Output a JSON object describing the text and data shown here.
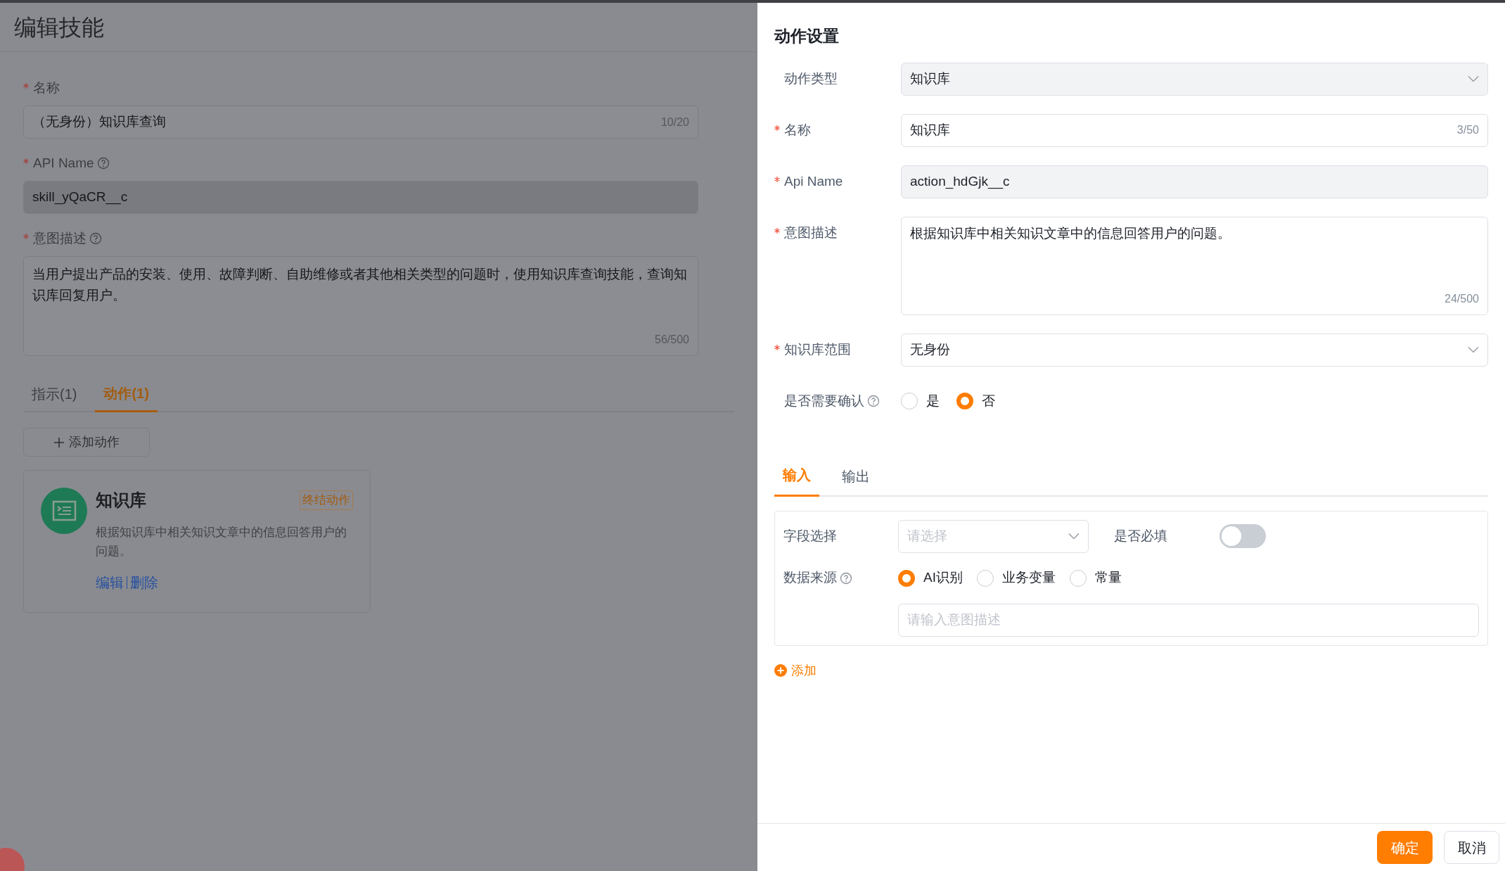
{
  "page": {
    "title": "编辑技能",
    "fields": [
      {
        "label": "名称",
        "required": true,
        "help": false,
        "kind": "input",
        "value": "（无身份）知识库查询",
        "counter": "10/20",
        "disabled": false
      },
      {
        "label": "API Name",
        "required": true,
        "help": true,
        "kind": "input",
        "value": "skill_yQaCR__c",
        "disabled": true
      },
      {
        "label": "意图描述",
        "required": true,
        "help": true,
        "kind": "textarea",
        "value": "当用户提出产品的安装、使用、故障判断、自助维修或者其他相关类型的问题时，使用知识库查询技能，查询知识库回复用户。",
        "counter": "56/500",
        "disabled": false
      }
    ],
    "tabs": [
      {
        "label": "指示(1)",
        "selected": false
      },
      {
        "label": "动作(1)",
        "selected": true
      }
    ],
    "add_action_button": "添加动作",
    "action_card": {
      "title": "知识库",
      "tag": "终结动作",
      "description": "根据知识库中相关知识文章中的信息回答用户的问题。",
      "links": [
        "编辑",
        "删除"
      ]
    }
  },
  "drawer": {
    "title": "动作设置",
    "fields": [
      {
        "label": "动作类型",
        "required": false,
        "help": false,
        "kind": "select",
        "value": "知识库",
        "disabled": true
      },
      {
        "label": "名称",
        "required": true,
        "help": false,
        "kind": "input",
        "value": "知识库",
        "counter": "3/50",
        "disabled": false
      },
      {
        "label": "Api Name",
        "required": true,
        "help": false,
        "kind": "input",
        "value": "action_hdGjk__c",
        "disabled": true
      },
      {
        "label": "意图描述",
        "required": true,
        "help": false,
        "kind": "textarea",
        "value": "根据知识库中相关知识文章中的信息回答用户的问题。",
        "counter": "24/500",
        "disabled": false
      },
      {
        "label": "知识库范围",
        "required": true,
        "help": false,
        "kind": "select",
        "value": "无身份",
        "disabled": false
      },
      {
        "label": "是否需要确认",
        "required": false,
        "help": true,
        "kind": "radio",
        "options": [
          {
            "label": "是",
            "selected": false
          },
          {
            "label": "否",
            "selected": true
          }
        ]
      }
    ],
    "tabs": [
      {
        "label": "输入",
        "selected": true
      },
      {
        "label": "输出",
        "selected": false
      }
    ],
    "mapping": {
      "field_select": {
        "label": "字段选择",
        "placeholder": "请选择"
      },
      "required": {
        "label": "是否必填",
        "on": false
      },
      "source": {
        "label": "数据来源",
        "help": true,
        "options": [
          {
            "label": "AI识别",
            "selected": true
          },
          {
            "label": "业务变量",
            "selected": false
          },
          {
            "label": "常量",
            "selected": false
          }
        ]
      },
      "input": {
        "placeholder": "请输入意图描述"
      }
    },
    "add_link": "添加",
    "buttons": [
      {
        "label": "确定",
        "kind": "primary"
      },
      {
        "label": "取消",
        "kind": "default"
      }
    ]
  }
}
